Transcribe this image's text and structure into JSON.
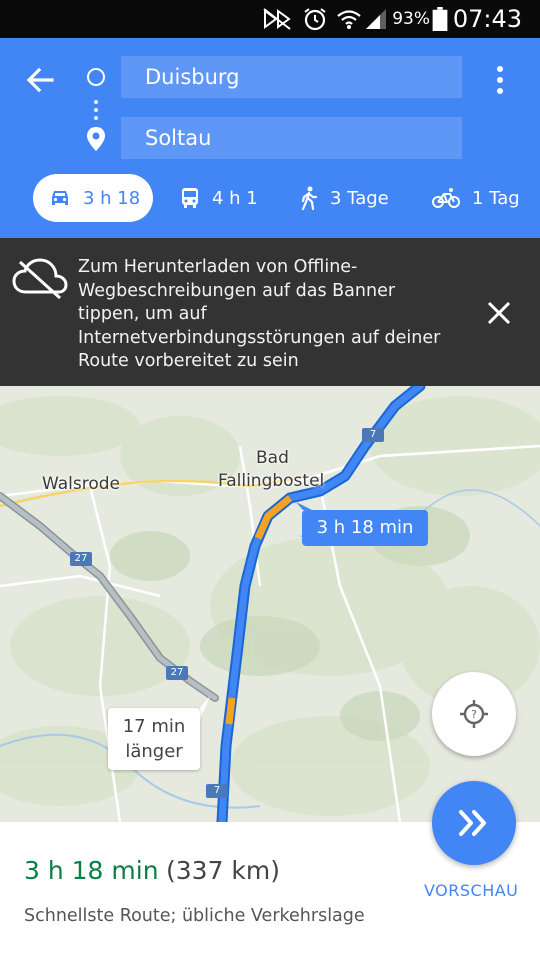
{
  "status_bar": {
    "battery": "93%",
    "time": "07:43",
    "icons": [
      "nfc-muted-icon",
      "alarm-icon",
      "wifi-icon",
      "signal-icon",
      "battery-icon"
    ]
  },
  "header": {
    "origin": "Duisburg",
    "destination": "Soltau",
    "modes": [
      {
        "icon": "car-icon",
        "label": "3 h 18",
        "selected": true
      },
      {
        "icon": "transit-icon",
        "label": "4 h 1",
        "selected": false
      },
      {
        "icon": "walk-icon",
        "label": "3 Tage",
        "selected": false
      },
      {
        "icon": "bike-icon",
        "label": "1 Tag",
        "selected": false
      }
    ]
  },
  "banner": {
    "icon": "cloud-off-icon",
    "text": "Zum Herunterladen von Offline-Wegbeschreibungen auf das Banner tippen, um auf Internetverbindungsstörungen auf deiner Route vorbereitet zu sein"
  },
  "map": {
    "places": {
      "walsrode": "Walsrode",
      "bad": "Bad",
      "fallingbostel": "Fallingbostel"
    },
    "route_callout": "3 h 18 min",
    "alt_callout_line1": "17 min",
    "alt_callout_line2": "länger",
    "shields": [
      "7",
      "27",
      "27",
      "7"
    ]
  },
  "sheet": {
    "duration": "3 h 18 min",
    "distance": "(337 km)",
    "note": "Schnellste Route; übliche Verkehrslage",
    "preview_label": "VORSCHAU"
  },
  "colors": {
    "primary": "#4285f4",
    "duration_green": "#0b8043",
    "traffic_orange": "#f4a21f"
  }
}
